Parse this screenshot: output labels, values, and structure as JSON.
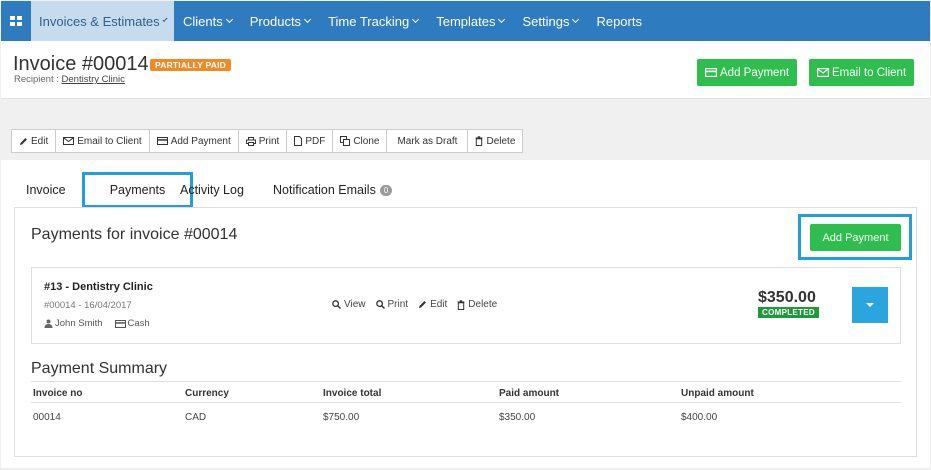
{
  "nav": {
    "items": [
      {
        "label": "Invoices & Estimates",
        "dropdown": true,
        "active": true
      },
      {
        "label": "Clients",
        "dropdown": true
      },
      {
        "label": "Products",
        "dropdown": true
      },
      {
        "label": "Time Tracking",
        "dropdown": true
      },
      {
        "label": "Templates",
        "dropdown": true
      },
      {
        "label": "Settings",
        "dropdown": true
      },
      {
        "label": "Reports",
        "dropdown": false
      }
    ]
  },
  "header": {
    "title": "Invoice #00014",
    "status_badge": "PARTIALLY PAID",
    "recipient_label": "Recipient :",
    "recipient_name": "Dentistry Clinic",
    "add_payment_label": "Add Payment",
    "email_client_label": "Email to Client"
  },
  "toolbar": {
    "edit": "Edit",
    "email": "Email to Client",
    "add_payment": "Add Payment",
    "print": "Print",
    "pdf": "PDF",
    "clone": "Clone",
    "draft": "Mark as Draft",
    "delete": "Delete"
  },
  "tabs": {
    "invoice": "Invoice",
    "payments": "Payments",
    "activity": "Activity Log",
    "notifications": "Notification Emails",
    "notifications_count": "0"
  },
  "payments_panel": {
    "title": "Payments for invoice #00014",
    "add_button": "Add Payment",
    "payment": {
      "title": "#13 - Dentistry Clinic",
      "ref": "#00014 - 16/04/2017",
      "user": "John Smith",
      "method": "Cash",
      "view": "View",
      "print": "Print",
      "edit": "Edit",
      "delete": "Delete",
      "amount": "$350.00",
      "status": "COMPLETED"
    }
  },
  "summary": {
    "title": "Payment Summary",
    "headers": {
      "invoice_no": "Invoice no",
      "currency": "Currency",
      "invoice_total": "Invoice total",
      "paid_amount": "Paid amount",
      "unpaid_amount": "Unpaid amount"
    },
    "row": {
      "invoice_no": "00014",
      "currency": "CAD",
      "invoice_total": "$750.00",
      "paid_amount": "$350.00",
      "unpaid_amount": "$400.00"
    }
  },
  "colors": {
    "nav_bg": "#2f7bbf",
    "green": "#2dbe4e",
    "highlight": "#1ea0e0",
    "badge_orange": "#f08a24"
  }
}
